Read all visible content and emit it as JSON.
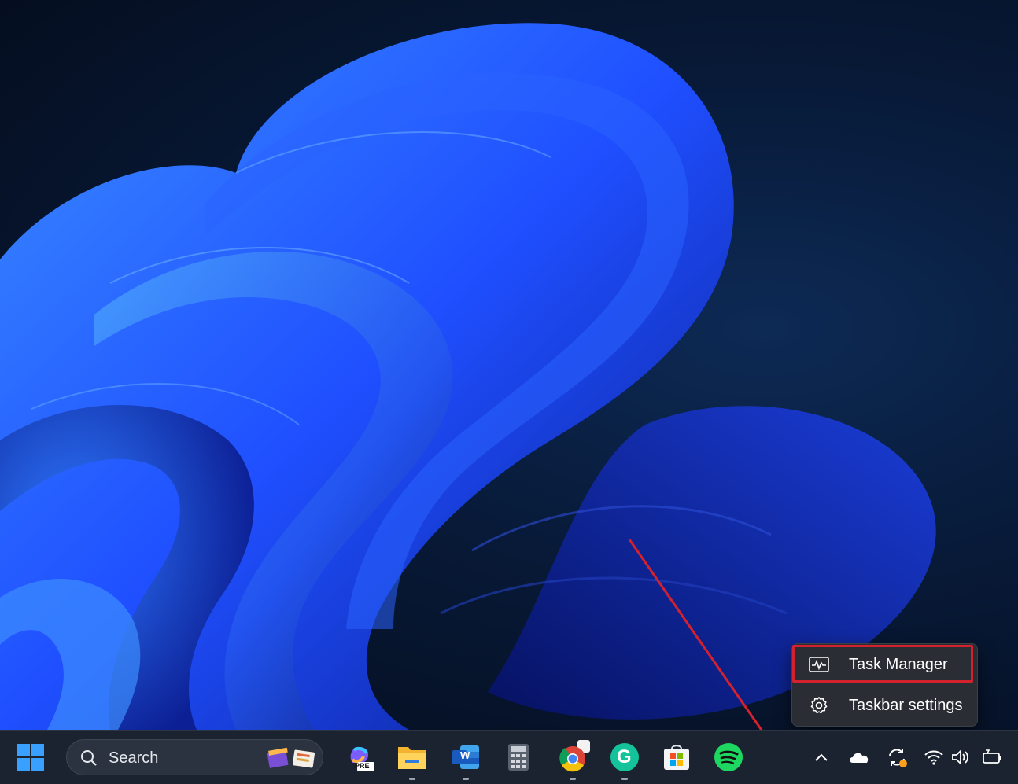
{
  "context_menu": {
    "items": [
      {
        "label": "Task Manager",
        "icon": "task-manager-icon",
        "highlighted": true
      },
      {
        "label": "Taskbar settings",
        "icon": "gear-icon",
        "highlighted": false
      }
    ],
    "highlight_color": "#d4212e"
  },
  "taskbar": {
    "search": {
      "label": "Search"
    },
    "pinned_apps": [
      {
        "name": "Start",
        "icon": "windows-start-icon"
      },
      {
        "name": "Copilot PRE",
        "icon": "copilot-icon",
        "badge": "PRE",
        "running": false
      },
      {
        "name": "File Explorer",
        "icon": "file-explorer-icon",
        "running": true
      },
      {
        "name": "Word",
        "icon": "word-icon",
        "badge": "W",
        "running": true
      },
      {
        "name": "Calculator",
        "icon": "calculator-icon",
        "running": false
      },
      {
        "name": "Chrome",
        "icon": "chrome-icon",
        "running": true
      },
      {
        "name": "Grammarly",
        "icon": "grammarly-icon",
        "badge": "G",
        "running": true
      },
      {
        "name": "Microsoft Store",
        "icon": "store-icon",
        "running": false
      },
      {
        "name": "Spotify",
        "icon": "spotify-icon",
        "running": false
      }
    ],
    "tray_icons": [
      "chevron-up-icon",
      "onedrive-cloud-icon",
      "sync-icon",
      "wifi-icon",
      "volume-icon",
      "battery-icon"
    ]
  },
  "colors": {
    "accent": "#1f5cff",
    "arrow": "#d4212e",
    "taskbar_bg": "#1c2330",
    "menu_bg": "#2a2d33"
  }
}
